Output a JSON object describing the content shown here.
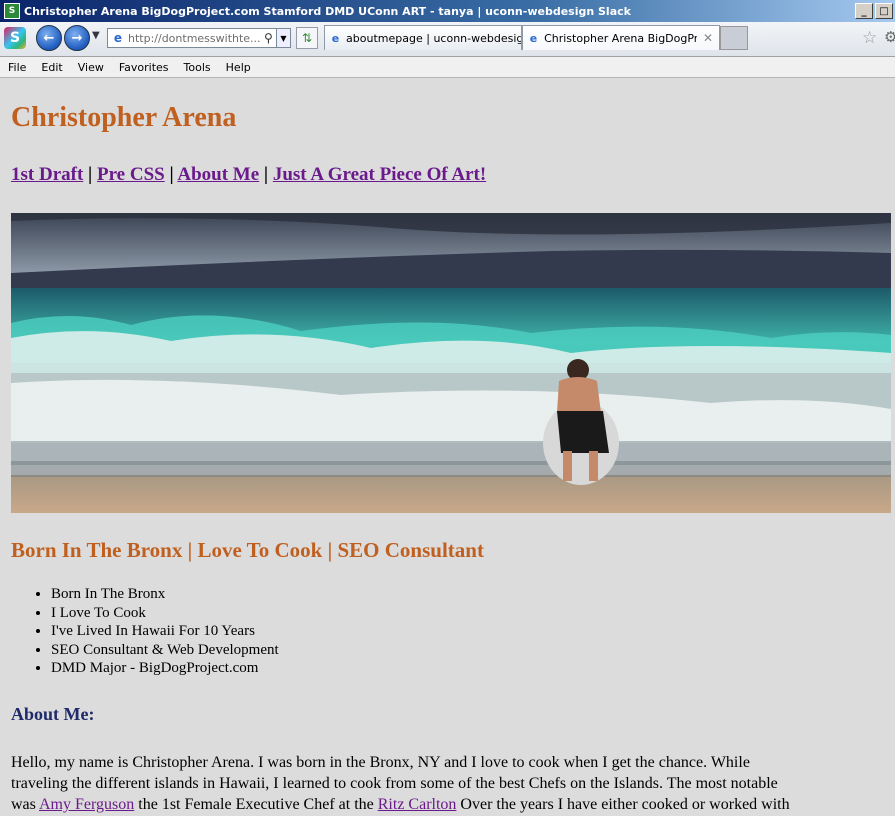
{
  "window": {
    "title": "Christopher Arena BigDogProject.com Stamford DMD UConn ART - tanya | uconn-webdesign Slack",
    "app_icon": "S",
    "minimize": "_",
    "maximize": "□"
  },
  "toolbar": {
    "slack_icon": "S",
    "address_value": "http://dontmesswithte...",
    "tabs": [
      {
        "label": "aboutmepage | uconn-webdesig..."
      },
      {
        "label": "Christopher Arena BigDogPr...",
        "close": "✕"
      }
    ]
  },
  "menu": [
    "File",
    "Edit",
    "View",
    "Favorites",
    "Tools",
    "Help"
  ],
  "page": {
    "heading": "Christopher Arena",
    "nav": [
      "1st Draft",
      "Pre CSS",
      "About Me",
      "Just A Great Piece Of Art!"
    ],
    "nav_separator": "|",
    "subheading": "Born In The Bronx | Love To Cook | SEO Consultant",
    "facts": [
      "Born In The Bronx",
      "I Love To Cook",
      "I've Lived In Hawaii For 10 Years",
      "SEO Consultant & Web Development",
      "DMD Major - BigDogProject.com"
    ],
    "about_heading": "About Me:",
    "para": {
      "line1": "Hello, my name is Christopher Arena. I was born in the Bronx, NY and I love to cook when I get the chance. While",
      "line2": "traveling the different islands in Hawaii, I learned to cook from some of the best Chefs on the Islands. The most notable",
      "line3_a": "was ",
      "link1": "Amy Ferguson",
      "line3_b": " the 1st Female Executive Chef at the ",
      "link2": "Ritz Carlton",
      "line3_c": " Over the years I have either cooked or worked with"
    }
  },
  "colors": {
    "heading": "#c06020",
    "link": "#6a1a8a",
    "about": "#1e2a6a",
    "page_bg": "#dcdcdc"
  }
}
